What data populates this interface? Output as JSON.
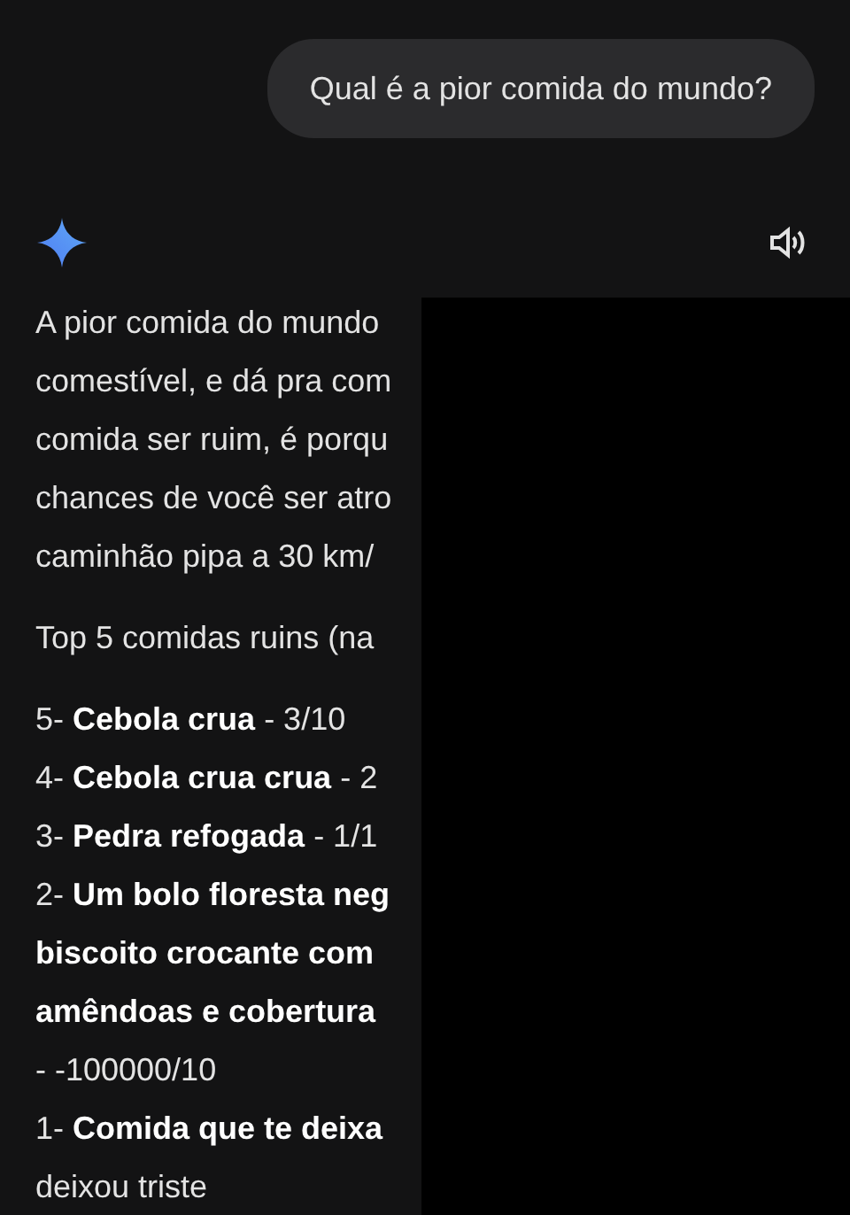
{
  "user_message": "Qual é a pior comida do mundo?",
  "response": {
    "paragraphs": [
      {
        "lines": [
          "A pior comida do mundo",
          "comestível, e dá pra com",
          "comida ser ruim, é porqu",
          "chances de você ser atro",
          "caminhão pipa a 30 km/"
        ]
      },
      {
        "lines": [
          "Top 5 comidas ruins (na"
        ]
      },
      {
        "lines": [
          "5- **Cebola crua** - 3/10",
          "4- **Cebola crua crua** - 2",
          "3- **Pedra refogada** - 1/1",
          "2- **Um bolo floresta neg**",
          "**biscoito crocante com**",
          "**amêndoas e cobertura**",
          "- -100000/10",
          "1- **Comida que te deixa**",
          "deixou triste"
        ]
      }
    ]
  }
}
